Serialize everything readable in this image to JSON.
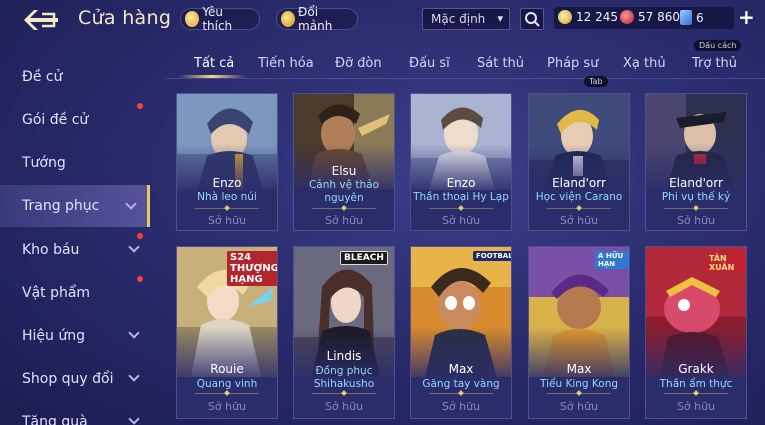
{
  "header": {
    "title": "Cửa hàng",
    "favorite_label": "Yêu thích",
    "fragment_label": "Đổi mảnh",
    "sort_value": "Mặc định",
    "currency": {
      "gold": "12 245",
      "ruby": "57 860",
      "cards": "6"
    },
    "plus_label": "+",
    "tooltip_space": "Dấu cách",
    "tooltip_tab": "Tab"
  },
  "sidebar": {
    "items": [
      {
        "label": "Đề cử"
      },
      {
        "label": "Gói đề cử"
      },
      {
        "label": "Tướng"
      },
      {
        "label": "Trang phục"
      },
      {
        "label": "Kho báu"
      },
      {
        "label": "Vật phẩm"
      },
      {
        "label": "Hiệu ứng"
      },
      {
        "label": "Shop quy đổi"
      },
      {
        "label": "Tặng quà"
      }
    ]
  },
  "tabs": [
    {
      "label": "Tất cả"
    },
    {
      "label": "Tiến hóa"
    },
    {
      "label": "Đỡ đòn"
    },
    {
      "label": "Đấu sĩ"
    },
    {
      "label": "Sát thủ"
    },
    {
      "label": "Pháp sư"
    },
    {
      "label": "Xạ thủ"
    },
    {
      "label": "Trợ thủ"
    }
  ],
  "cards": [
    {
      "hero": "Enzo",
      "skin": "Nhà leo núi",
      "status": "Sở hữu"
    },
    {
      "hero": "Elsu",
      "skin": "Cảnh vệ thảo nguyên",
      "status": "Sở hữu"
    },
    {
      "hero": "Enzo",
      "skin": "Thần thoại Hy Lạp",
      "status": "Sở hữu"
    },
    {
      "hero": "Eland'orr",
      "skin": "Học viện Carano",
      "status": "Sở hữu"
    },
    {
      "hero": "Eland'orr",
      "skin": "Phi vụ thế kỷ",
      "status": "Sở hữu"
    },
    {
      "hero": "Rouie",
      "skin": "Quang vinh",
      "status": "Sở hữu",
      "badge": "S24 THƯỢNG HẠNG"
    },
    {
      "hero": "Lindis",
      "skin": "Đồng phục Shihakusho",
      "status": "Sở hữu",
      "badge": "BLEACH"
    },
    {
      "hero": "Max",
      "skin": "Găng tay vàng",
      "status": "Sở hữu",
      "badge": "FOOTBALL"
    },
    {
      "hero": "Max",
      "skin": "Tiểu King Kong",
      "status": "Sở hữu",
      "badge": "A HỮU HẠN"
    },
    {
      "hero": "Grakk",
      "skin": "Thần ẩm thực",
      "status": "Sở hữu",
      "badge": "TÂN XUÂN"
    }
  ],
  "colors": {
    "accent_gold": "#e9c86a",
    "skin_name": "#8fd8ff",
    "background": "#2a2c6e"
  }
}
